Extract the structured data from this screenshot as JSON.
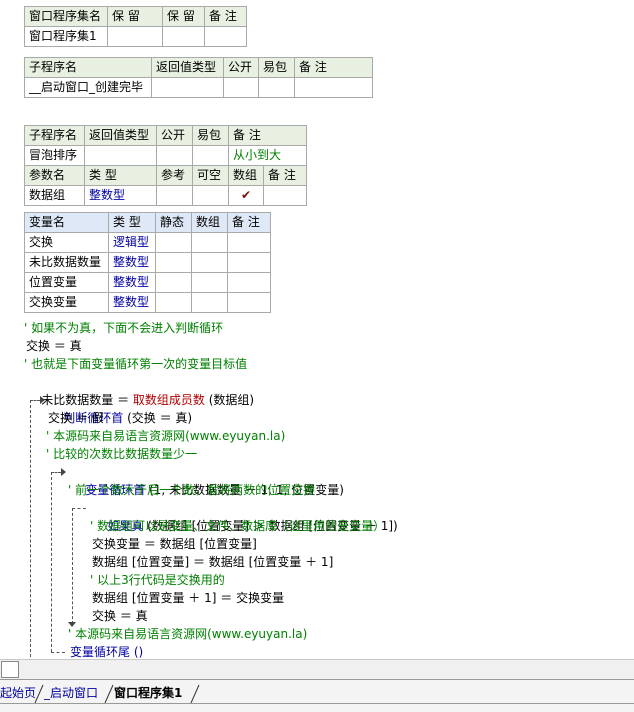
{
  "t1": {
    "headers": [
      "窗口程序集名",
      "保 留",
      "保 留",
      "备 注"
    ],
    "row": [
      "窗口程序集1",
      "",
      "",
      ""
    ]
  },
  "t2": {
    "headers": [
      "子程序名",
      "返回值类型",
      "公开",
      "易包",
      "备 注"
    ],
    "row": [
      "__启动窗口_创建完毕",
      "",
      "",
      "",
      ""
    ]
  },
  "t3": {
    "headers": [
      "子程序名",
      "返回值类型",
      "公开",
      "易包",
      "备 注"
    ],
    "row": [
      "冒泡排序",
      "",
      "",
      "",
      "从小到大"
    ],
    "param_headers": [
      "参数名",
      "类 型",
      "参考",
      "可空",
      "数组",
      "备 注"
    ],
    "param_row": [
      "数据组",
      "整数型",
      "",
      "",
      "✔",
      ""
    ]
  },
  "t4": {
    "headers": [
      "变量名",
      "类 型",
      "静态",
      "数组",
      "备 注"
    ],
    "rows": [
      [
        "交换",
        "逻辑型"
      ],
      [
        "未比数据数量",
        "整数型"
      ],
      [
        "位置变量",
        "整数型"
      ],
      [
        "交换变量",
        "整数型"
      ]
    ]
  },
  "code": {
    "l1": "' 如果不为真，下面不会进入判断循环",
    "l2": "交换 ＝ 真",
    "l3": "' 也就是下面变量循环第一次的变量目标值",
    "l4a": "未比数据数量 ＝ ",
    "l4b": "取数组成员数",
    "l4c": " (数据组)",
    "l5a": "判断循环首",
    "l5b": " (交换 ＝ 真)",
    "l6": "交换 ＝ 假",
    "l7": "' 本源码来自易语言资源网(www.eyuyan.la)",
    "l8": "' 比较的次数比数据数量少一",
    "l9a": "变量循环首",
    "l9b": " (1, 未比数据数量 － 1, 1, 位置变量)",
    "l10": "' 前一个数大于后一个数，就将两数的位置交换",
    "l11a": "如果真",
    "l11b": " (数据组 [位置变量] ＞ 数据组 [位置变量 ＋ 1])",
    "l12": "' 数据组可以是变量、文件、数据库（这里用的是变量）",
    "l13": "交换变量 ＝ 数据组 [位置变量]",
    "l14": "数据组 [位置变量] ＝ 数据组 [位置变量 ＋ 1]",
    "l15": "' 以上3行代码是交换用的",
    "l16": "数据组 [位置变量 ＋ 1] ＝ 交换变量",
    "l17": "交换 ＝ 真",
    "l18": "' 本源码来自易语言资源网(www.eyuyan.la)",
    "l19": "变量循环尾 ()"
  },
  "tabs": [
    "起始页",
    "_启动窗口",
    "窗口程序集1"
  ]
}
